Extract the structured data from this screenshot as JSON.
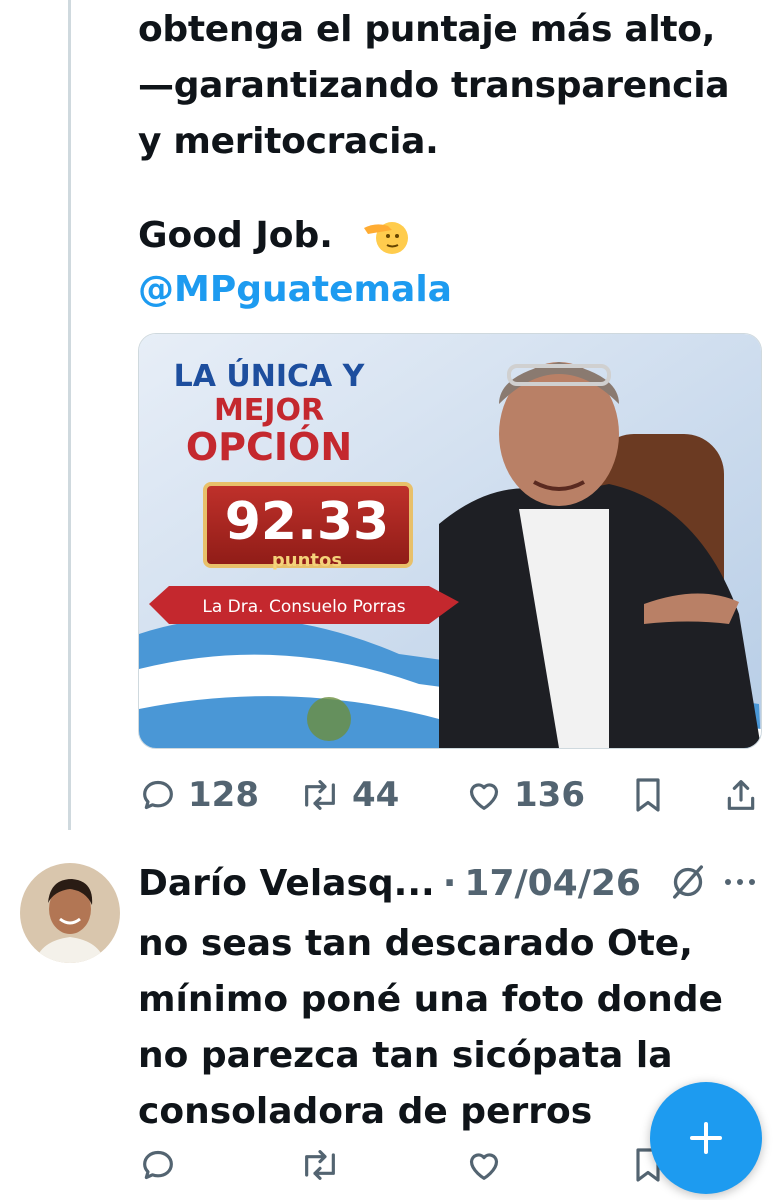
{
  "tweet": {
    "text_lines": [
      "obtenga el puntaje más alto,",
      "—garantizando transparencia",
      "y meritocracia."
    ],
    "closing": "Good Job.",
    "emoji_icon": "saluting-face-emoji",
    "mention": "@MPguatemala",
    "media": {
      "headline_1": "LA ÚNICA Y",
      "headline_2": "MEJOR",
      "headline_3": "OPCIÓN",
      "score": "92.33",
      "score_unit": "puntos",
      "ribbon": "La Dra. Consuelo Porras"
    },
    "actions": {
      "replies": "128",
      "reposts": "44",
      "likes": "136"
    }
  },
  "reply": {
    "author": "Darío Velasq...",
    "separator": "·",
    "date": "17/04/26",
    "text_lines": [
      "no seas tan descarado Ote,",
      "mínimo poné una foto donde",
      "no parezca tan sicópata  la",
      "consoladora de perros"
    ]
  },
  "colors": {
    "accent": "#1d9bf0",
    "text": "#0f1419",
    "muted": "#536471",
    "thread_line": "#cfd9de"
  }
}
